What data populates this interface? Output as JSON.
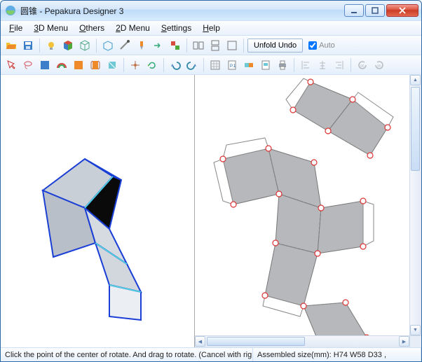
{
  "window": {
    "title": "圆锥 - Pepakura Designer 3"
  },
  "menu": {
    "file": "File",
    "menu3d": "3D Menu",
    "others": "Others",
    "menu2d": "2D Menu",
    "settings": "Settings",
    "help": "Help"
  },
  "toolbar": {
    "unfold_label": "Unfold Undo",
    "auto_label": "Auto",
    "auto_checked": true,
    "icons": {
      "open": "open-icon",
      "save": "save-icon",
      "light": "light-icon",
      "colorcube": "colorcube-icon",
      "wireframe": "wireframe-icon",
      "opencube": "opencube-icon",
      "edge-edit": "edge-edit-icon",
      "knife": "knife-icon",
      "arrow": "arrow-icon",
      "color-swap": "color-swap-icon",
      "layout-lr": "layout-lr-icon",
      "layout-tb": "layout-tb-icon",
      "layout-single": "layout-single-icon"
    }
  },
  "toolbar2": {
    "select": "select-icon",
    "lasso": "lasso-icon",
    "texture": "texture-icon",
    "rainbow": "rainbow-icon",
    "color": "color-icon",
    "flaps": "flaps-icon",
    "fold": "fold-icon",
    "anchor": "anchor-icon",
    "rotate": "rotate-icon",
    "undo": "undo-icon",
    "redo": "redo-icon",
    "grid": "grid-icon",
    "page": "page-icon",
    "edgeid": "edgeid-icon",
    "showpage": "showpage-icon",
    "print": "print-icon",
    "align-l": "align-left-icon",
    "align-c": "align-center-icon",
    "align-r": "align-right-icon",
    "rot90l": "rotate-left-icon",
    "rot90r": "rotate-right-icon"
  },
  "status": {
    "left": "Click the point of the center of rotate. And drag to rotate. (Cancel with right click)",
    "right": "Assembled size(mm): H74 W58 D33 ,"
  },
  "viewport": {
    "left_desc": "3D model view",
    "right_desc": "2D unfolded pattern view"
  }
}
